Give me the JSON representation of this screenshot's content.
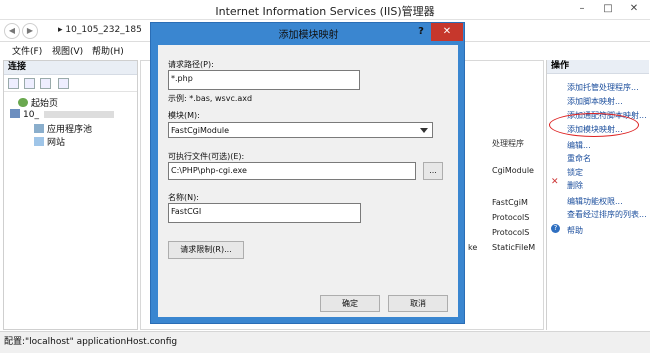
{
  "window": {
    "title": "Internet Information Services (IIS)管理器",
    "minimize_glyph": "–",
    "maximize_glyph": "□",
    "close_glyph": "✕"
  },
  "address": {
    "back_glyph": "◀",
    "forward_glyph": "▶",
    "path": "▸ 10_105_232_185"
  },
  "menu": {
    "file": "文件(F)",
    "view": "视图(V)",
    "help": "帮助(H)"
  },
  "connections": {
    "header": "连接",
    "tree": [
      "起始页",
      "10_",
      "应用程序池",
      "网站"
    ]
  },
  "middle": {
    "column_header": "处理程序",
    "rows": [
      "CgiModule",
      "FastCgiM",
      "ProtocolS",
      "ProtocolS",
      "StaticFileM"
    ],
    "ext_fragment": "ke"
  },
  "actions": {
    "header": "操作",
    "items": [
      "添加托管处理程序...",
      "添加脚本映射...",
      "添加通配符脚本映射...",
      "添加模块映射...",
      "编辑...",
      "重命名",
      "锁定",
      "删除",
      "编辑功能权限...",
      "查看经过排序的列表...",
      "帮助"
    ],
    "delete_glyph": "✕",
    "help_glyph": "?"
  },
  "statusbar": {
    "text": "配置:\"localhost\" applicationHost.config"
  },
  "dialog": {
    "title": "添加模块映射",
    "help_glyph": "?",
    "close_glyph": "✕",
    "request_path_label": "请求路径(P):",
    "request_path_value": "*.php",
    "example_text": "示例: *.bas, wsvc.axd",
    "module_label": "模块(M):",
    "module_value": "FastCgiModule",
    "executable_label": "可执行文件(可选)(E):",
    "executable_value": "C:\\PHP\\php-cgi.exe",
    "browse_label": "...",
    "name_label": "名称(N):",
    "name_value": "FastCGI",
    "restrictions_button": "请求限制(R)...",
    "ok_button": "确定",
    "cancel_button": "取消"
  },
  "colors": {
    "dialog_frame": "#3a86d0",
    "close_red": "#c6372c",
    "link_blue": "#1a4d9c",
    "callout_red": "#dd2222"
  }
}
